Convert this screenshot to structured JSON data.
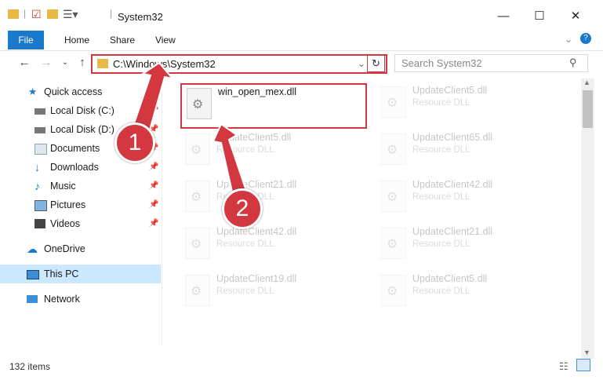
{
  "window": {
    "title": "System32"
  },
  "ribbon": {
    "file": "File",
    "tabs": [
      "Home",
      "Share",
      "View"
    ]
  },
  "address": {
    "path": "C:\\Windows\\System32"
  },
  "search": {
    "placeholder": "Search System32"
  },
  "nav": {
    "quick_access": "Quick access",
    "items": [
      "Local Disk (C:)",
      "Local Disk (D:)",
      "Documents",
      "Downloads",
      "Music",
      "Pictures",
      "Videos"
    ],
    "onedrive": "OneDrive",
    "this_pc": "This PC",
    "network": "Network"
  },
  "files": {
    "highlighted": {
      "name": "win_open_mex.dll",
      "type": ""
    },
    "left": [
      {
        "name": "UpdateClient5.dll",
        "type": "Resource DLL"
      },
      {
        "name": "UpdateClient21.dll",
        "type": "Resource DLL"
      },
      {
        "name": "UpdateClient42.dll",
        "type": "Resource DLL"
      },
      {
        "name": "UpdateClient19.dll",
        "type": "Resource DLL"
      }
    ],
    "right": [
      {
        "name": "UpdateClient5.dll",
        "type": "Resource DLL"
      },
      {
        "name": "UpdateClient65.dll",
        "type": "Resource DLL"
      },
      {
        "name": "UpdateClient42.dll",
        "type": "Resource DLL"
      },
      {
        "name": "UpdateClient21.dll",
        "type": "Resource DLL"
      },
      {
        "name": "UpdateClient5.dll",
        "type": "Resource DLL"
      }
    ]
  },
  "status": {
    "count": "132 items"
  },
  "callouts": {
    "one": "1",
    "two": "2"
  },
  "colors": {
    "accent": "#1979ca",
    "highlight": "#d33740",
    "selected": "#cce8ff"
  }
}
